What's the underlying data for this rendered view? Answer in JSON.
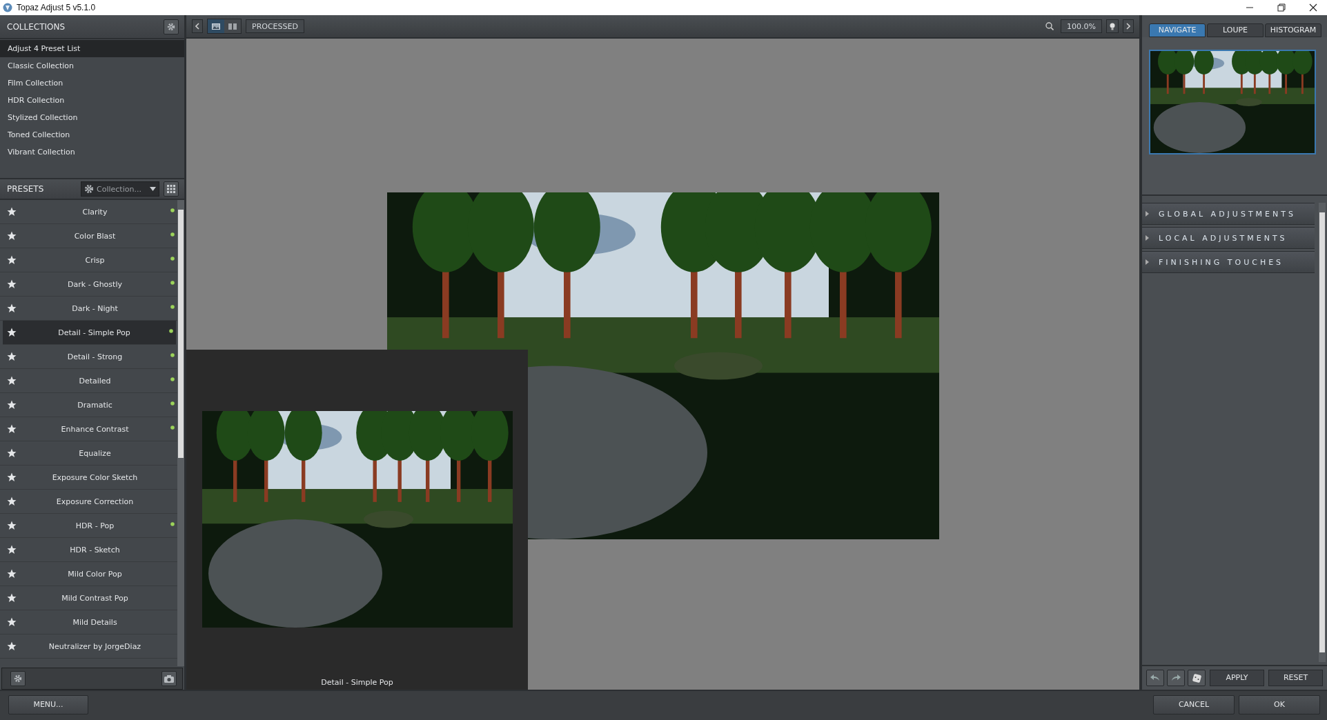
{
  "window": {
    "title": "Topaz Adjust 5 v5.1.0"
  },
  "collections": {
    "title": "COLLECTIONS",
    "items": [
      {
        "label": "Adjust 4 Preset List",
        "selected": true
      },
      {
        "label": "Classic Collection",
        "selected": false
      },
      {
        "label": "Film Collection",
        "selected": false
      },
      {
        "label": "HDR Collection",
        "selected": false
      },
      {
        "label": "Stylized Collection",
        "selected": false
      },
      {
        "label": "Toned Collection",
        "selected": false
      },
      {
        "label": "Vibrant Collection",
        "selected": false
      }
    ]
  },
  "presets": {
    "title": "PRESETS",
    "filter": "Collection...",
    "items": [
      {
        "label": "Clarity",
        "selected": false,
        "marked": true
      },
      {
        "label": "Color Blast",
        "selected": false,
        "marked": true
      },
      {
        "label": "Crisp",
        "selected": false,
        "marked": true
      },
      {
        "label": "Dark - Ghostly",
        "selected": false,
        "marked": true
      },
      {
        "label": "Dark - Night",
        "selected": false,
        "marked": true
      },
      {
        "label": "Detail - Simple Pop",
        "selected": true,
        "marked": true
      },
      {
        "label": "Detail - Strong",
        "selected": false,
        "marked": true
      },
      {
        "label": "Detailed",
        "selected": false,
        "marked": true
      },
      {
        "label": "Dramatic",
        "selected": false,
        "marked": true
      },
      {
        "label": "Enhance Contrast",
        "selected": false,
        "marked": true
      },
      {
        "label": "Equalize",
        "selected": false,
        "marked": false
      },
      {
        "label": "Exposure Color Sketch",
        "selected": false,
        "marked": false
      },
      {
        "label": "Exposure Correction",
        "selected": false,
        "marked": false
      },
      {
        "label": "HDR - Pop",
        "selected": false,
        "marked": true
      },
      {
        "label": "HDR - Sketch",
        "selected": false,
        "marked": false
      },
      {
        "label": "Mild Color Pop",
        "selected": false,
        "marked": false
      },
      {
        "label": "Mild Contrast Pop",
        "selected": false,
        "marked": false
      },
      {
        "label": "Mild Details",
        "selected": false,
        "marked": false
      },
      {
        "label": "Neutralizer by JorgeDiaz",
        "selected": false,
        "marked": false
      }
    ]
  },
  "toolbar": {
    "view_mode": "PROCESSED",
    "zoom": "100.0%",
    "views": [
      {
        "kind": "single",
        "selected": true
      },
      {
        "kind": "split",
        "selected": false
      }
    ]
  },
  "preview": {
    "caption": "Detail - Simple Pop"
  },
  "navigator": {
    "tabs": [
      {
        "label": "NAVIGATE",
        "selected": true
      },
      {
        "label": "LOUPE",
        "selected": false
      },
      {
        "label": "HISTOGRAM",
        "selected": false
      }
    ]
  },
  "sections": [
    {
      "label": "GLOBAL ADJUSTMENTS",
      "expanded": false
    },
    {
      "label": "LOCAL ADJUSTMENTS",
      "expanded": false
    },
    {
      "label": "FINISHING TOUCHES",
      "expanded": false
    }
  ],
  "actions": {
    "apply": "APPLY",
    "reset": "RESET"
  },
  "bottom_bar": {
    "menu": "MENU...",
    "cancel": "CANCEL",
    "ok": "OK"
  }
}
